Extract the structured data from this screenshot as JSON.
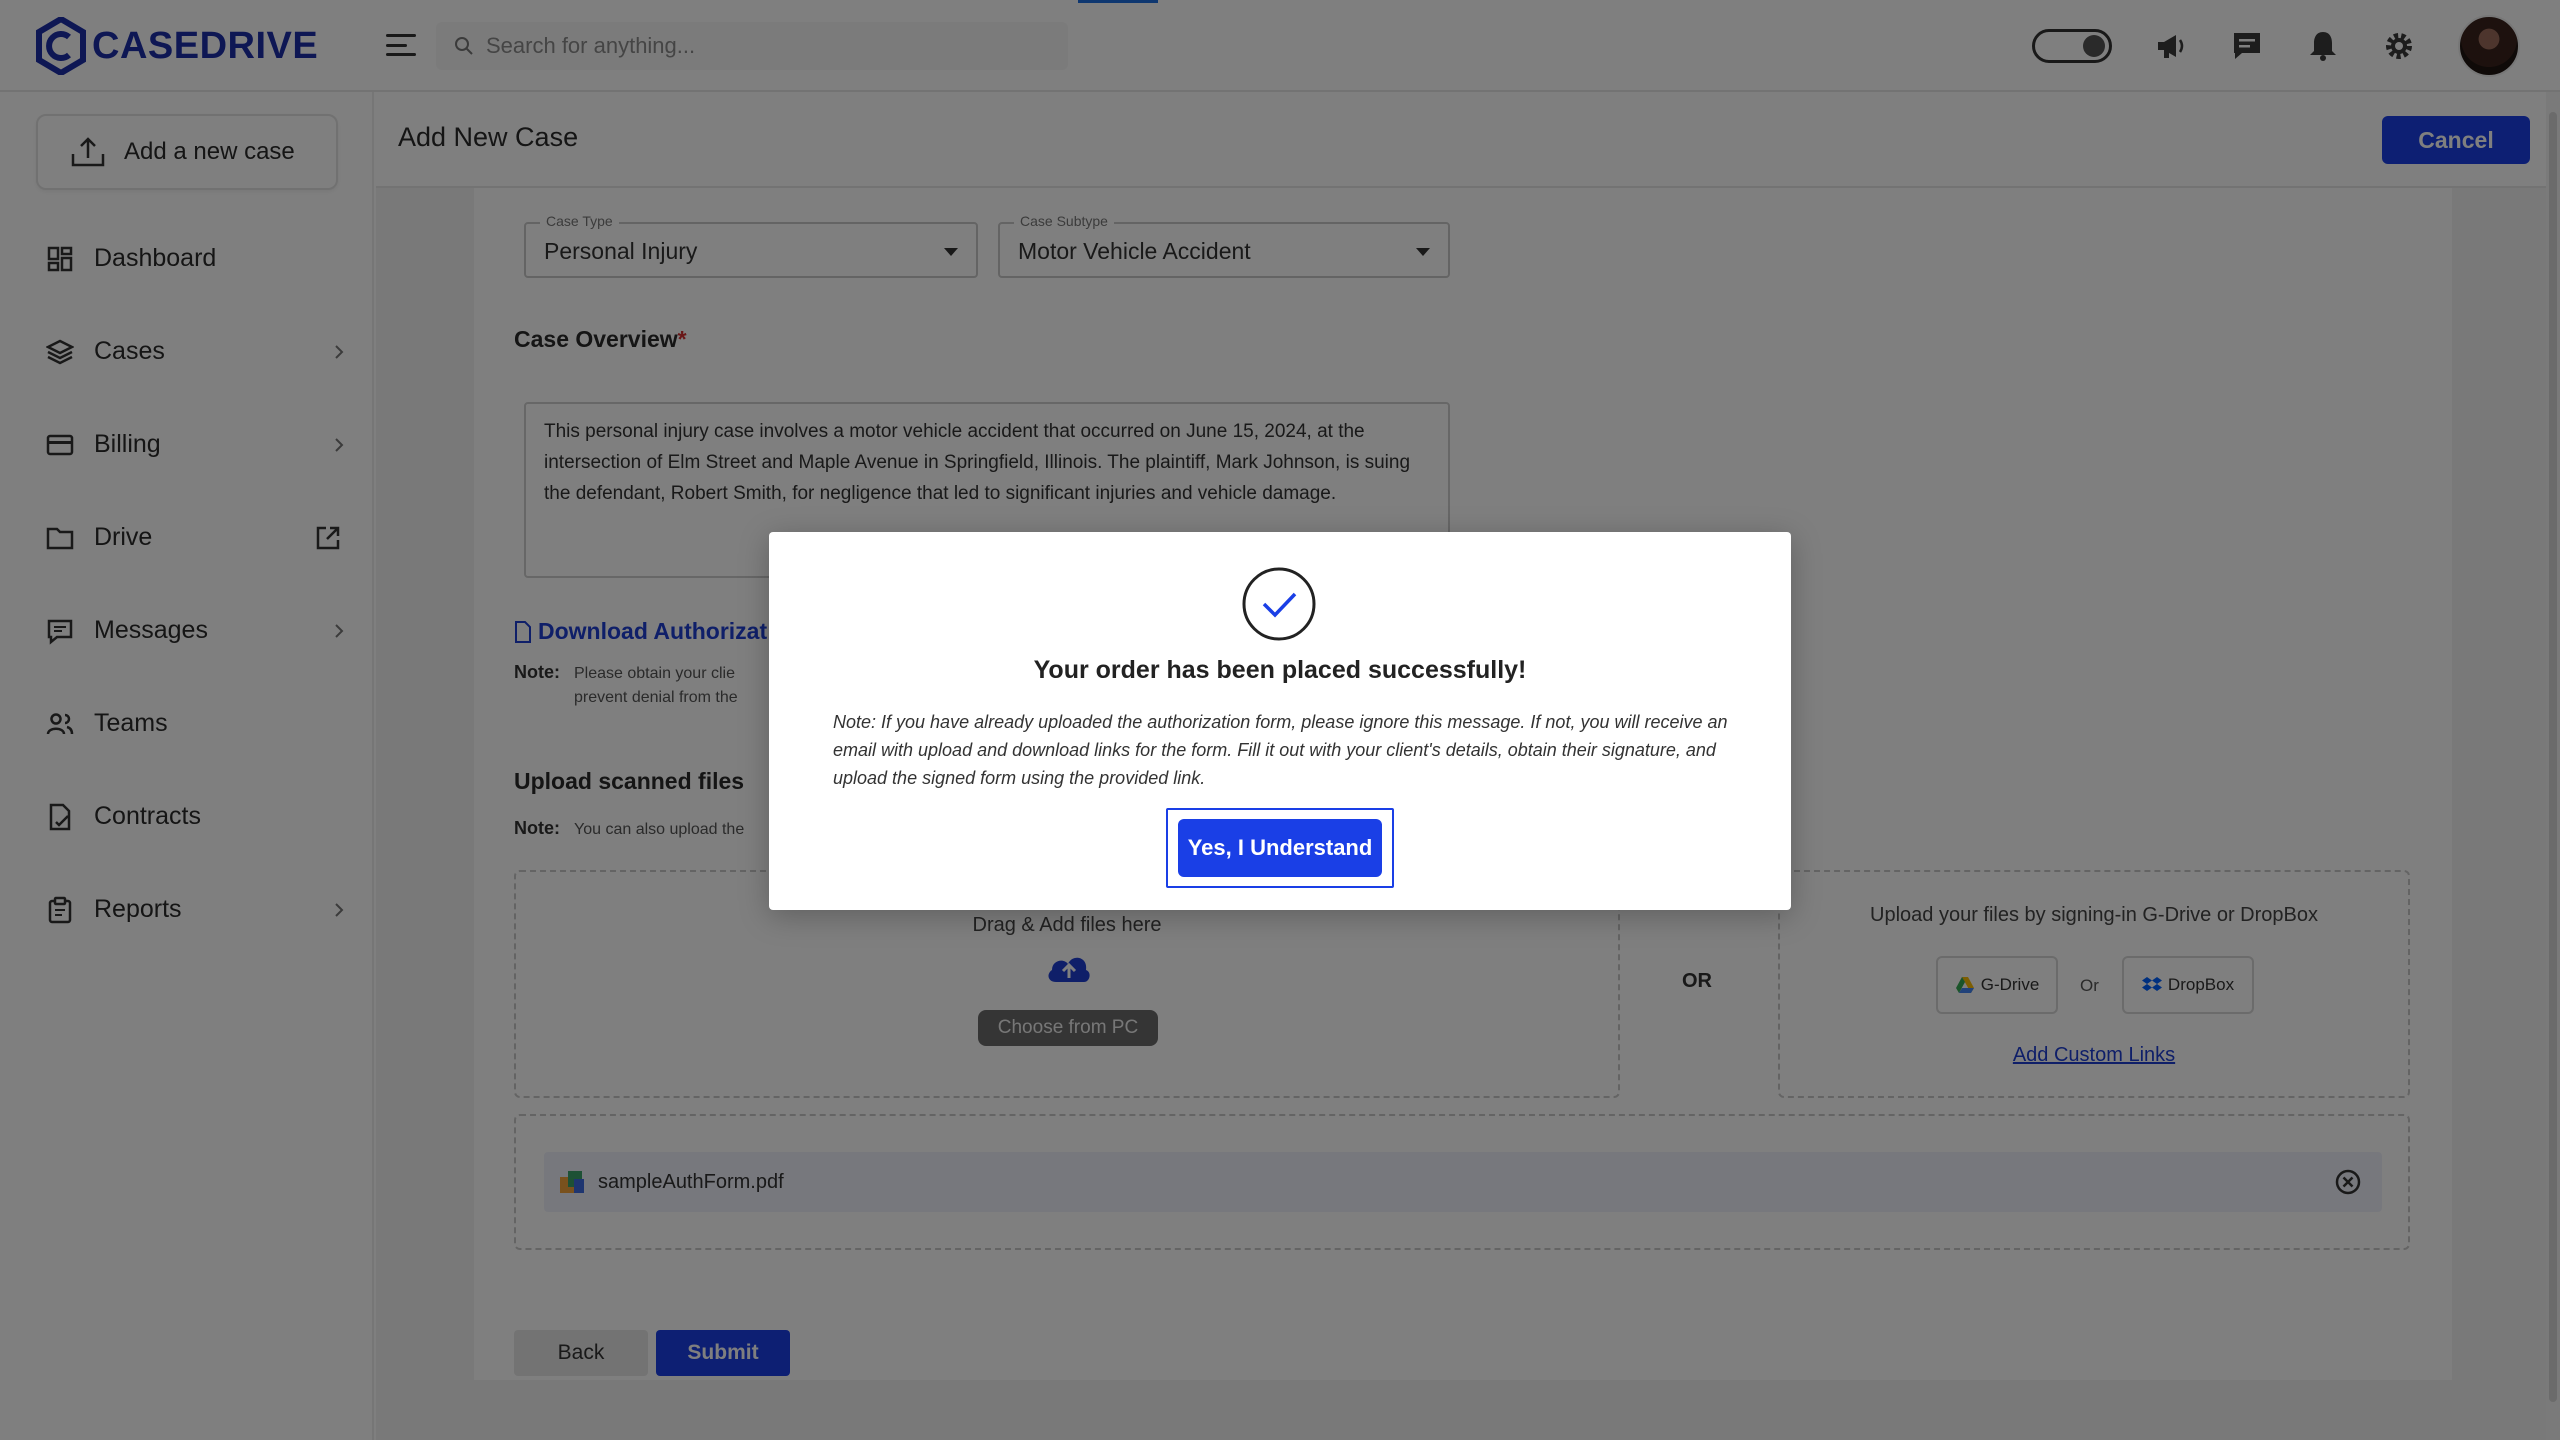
{
  "brand": {
    "name": "CASEDRIVE",
    "logo_color": "#1d2fa8"
  },
  "search": {
    "placeholder": "Search for anything..."
  },
  "top_icons": [
    "theme-toggle-icon",
    "megaphone-icon",
    "chat-icon",
    "bell-icon",
    "gear-icon"
  ],
  "sidebar": {
    "add_case_label": "Add a new case",
    "items": [
      {
        "label": "Dashboard",
        "icon": "dashboard-icon",
        "has_chevron": false
      },
      {
        "label": "Cases",
        "icon": "layers-icon",
        "has_chevron": true
      },
      {
        "label": "Billing",
        "icon": "card-icon",
        "has_chevron": true
      },
      {
        "label": "Drive",
        "icon": "folder-icon",
        "has_external": true
      },
      {
        "label": "Messages",
        "icon": "message-icon",
        "has_chevron": true
      },
      {
        "label": "Teams",
        "icon": "users-icon",
        "has_chevron": false
      },
      {
        "label": "Contracts",
        "icon": "contract-icon",
        "has_chevron": false
      },
      {
        "label": "Reports",
        "icon": "clipboard-icon",
        "has_chevron": true
      }
    ]
  },
  "header": {
    "title": "Add New Case",
    "cancel_label": "Cancel"
  },
  "form": {
    "case_type": {
      "label": "Case Type",
      "value": "Personal Injury"
    },
    "case_subtype": {
      "label": "Case Subtype",
      "value": "Motor Vehicle Accident"
    },
    "overview_label": "Case Overview",
    "overview_required": "*",
    "overview_text": "This personal injury case involves a motor vehicle accident that occurred on June 15, 2024, at the intersection of Elm Street and Maple Avenue in Springfield, Illinois. The plaintiff, Mark Johnson, is suing the defendant, Robert Smith, for negligence that led to significant injuries and vehicle damage.",
    "download_link": "Download Authorizat",
    "note_label": "Note:",
    "note1_line1": "Please obtain your clie",
    "note1_line2": "prevent denial from the",
    "upload_label": "Upload scanned files",
    "note2_text": "You can also upload the",
    "drop_title": "Drag & Add files here",
    "choose_label": "Choose from PC",
    "or_label": "OR",
    "cloud_title": "Upload your files by signing-in G-Drive or DropBox",
    "gdrive_label": "G-Drive",
    "svc_or": "Or",
    "dropbox_label": "DropBox",
    "custom_links": "Add Custom Links",
    "file_name": "sampleAuthForm.pdf",
    "back_label": "Back",
    "submit_label": "Submit"
  },
  "modal": {
    "title": "Your order has been placed successfully!",
    "note": "Note: If you have already uploaded the authorization form, please ignore this message. If not, you will receive an email with upload and download links for the form. Fill it out with your client's details, obtain their signature, and upload the signed form using the provided link.",
    "confirm_label": "Yes, I Understand"
  },
  "colors": {
    "primary": "#1a3fe6",
    "link": "#1f3fd2",
    "overlay": "rgba(0,0,0,0.5)"
  }
}
